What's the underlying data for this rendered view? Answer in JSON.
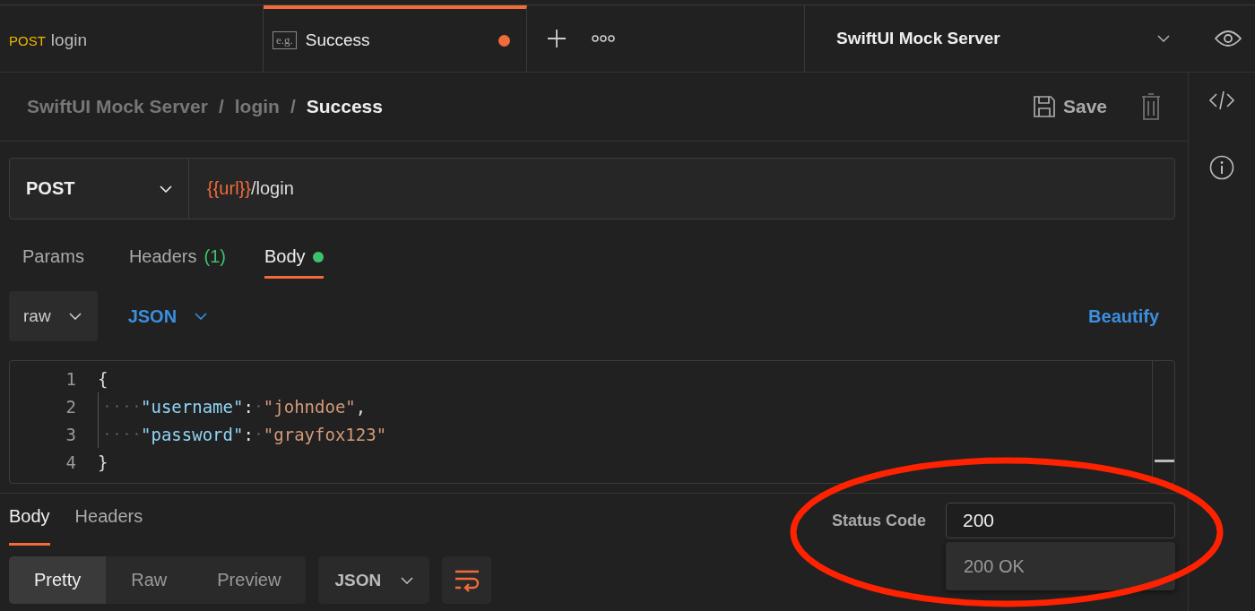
{
  "tabs": [
    {
      "kind": "request",
      "method": "POST",
      "label": "login",
      "selected": false,
      "unsaved": false
    },
    {
      "kind": "example",
      "badge": "e.g.",
      "label": "Success",
      "selected": true,
      "unsaved": true
    }
  ],
  "environment": {
    "name": "SwiftUI Mock Server"
  },
  "breadcrumb": {
    "separator": "/",
    "items": [
      "SwiftUI Mock Server",
      "login",
      "Success"
    ]
  },
  "save_label": "Save",
  "request": {
    "method": "POST",
    "url_variable": "{{url}}",
    "url_path": "/login"
  },
  "request_tabs": [
    {
      "label": "Params",
      "selected": false,
      "has_content": false
    },
    {
      "label": "Headers",
      "count": "(1)",
      "selected": false,
      "has_content": false
    },
    {
      "label": "Body",
      "selected": true,
      "has_content": true
    }
  ],
  "body_mode": "raw",
  "body_format": "JSON",
  "beautify": "Beautify",
  "editor": {
    "lines": [
      {
        "number": "1",
        "indent": false,
        "tokens": [
          {
            "kind": "punct",
            "text": "{"
          }
        ]
      },
      {
        "number": "2",
        "indent": true,
        "tokens": [
          {
            "kind": "key",
            "text": "\"username\""
          },
          {
            "kind": "punct",
            "text": ":"
          },
          {
            "kind": "space"
          },
          {
            "kind": "string",
            "text": "\"johndoe\""
          },
          {
            "kind": "punct",
            "text": ","
          }
        ]
      },
      {
        "number": "3",
        "indent": true,
        "tokens": [
          {
            "kind": "key",
            "text": "\"password\""
          },
          {
            "kind": "punct",
            "text": ":"
          },
          {
            "kind": "space"
          },
          {
            "kind": "string",
            "text": "\"grayfox123\""
          }
        ]
      },
      {
        "number": "4",
        "indent": false,
        "tokens": [
          {
            "kind": "punct",
            "text": "}"
          }
        ]
      }
    ]
  },
  "response_tabs": [
    {
      "label": "Body",
      "selected": true
    },
    {
      "label": "Headers",
      "selected": false
    }
  ],
  "view_modes": [
    {
      "label": "Pretty",
      "selected": true
    },
    {
      "label": "Raw",
      "selected": false
    },
    {
      "label": "Preview",
      "selected": false
    }
  ],
  "response_format": "JSON",
  "status_code": {
    "label": "Status Code",
    "value": "200",
    "suggestions": [
      "200 OK"
    ]
  }
}
